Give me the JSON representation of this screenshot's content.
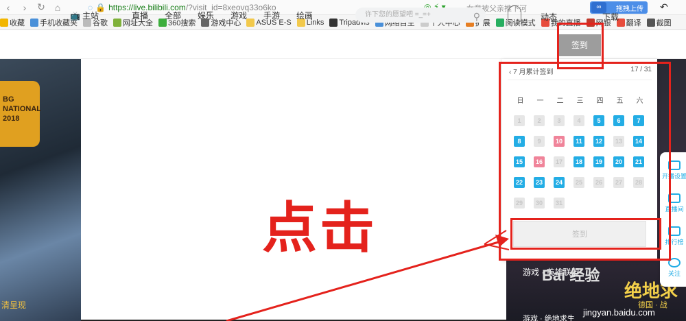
{
  "browser": {
    "url_main": "https://live.bilibili.com",
    "url_query": "/?visit_id=8xeovq33o6ko",
    "search_hint": "女童被父亲推下河",
    "upload_label": "拖拽上传",
    "upload_logo": "∞"
  },
  "bookmarks": [
    {
      "label": "收藏",
      "color": "#f2b600"
    },
    {
      "label": "手机收藏夹",
      "color": "#4a90d9"
    },
    {
      "label": "谷歌",
      "color": "#bbbbbb"
    },
    {
      "label": "网址大全",
      "color": "#7fb13a"
    },
    {
      "label": "360搜索",
      "color": "#3dae3d"
    },
    {
      "label": "游戏中心",
      "color": "#666666"
    },
    {
      "label": "ASUS E-S",
      "color": "#f2c94c"
    },
    {
      "label": "Links",
      "color": "#f2c94c"
    },
    {
      "label": "Tripadvis",
      "color": "#333333"
    },
    {
      "label": "网络自主",
      "color": "#4a90d9"
    },
    {
      "label": "个人中心",
      "color": "#cccccc"
    },
    {
      "label": "扩展",
      "color": "#e67e22"
    },
    {
      "label": "阅读模式",
      "color": "#27ae60"
    },
    {
      "label": "我的直播",
      "color": "#e74c3c"
    },
    {
      "label": "网银",
      "color": "#c0392b"
    },
    {
      "label": "翻译",
      "color": "#e74c3c"
    },
    {
      "label": "截图",
      "color": "#555555"
    }
  ],
  "site_nav": [
    "主站",
    "直播",
    "全部",
    "娱乐",
    "游戏",
    "手游",
    "绘画"
  ],
  "search_placeholder": "许下您的愿望吧 =_=+",
  "header_tabs": {
    "dynamic": "动态",
    "sign": "签到",
    "download": "下载"
  },
  "sign_panel": {
    "title": "7 月累计签到",
    "progress": "17 / 31",
    "weekdays": [
      "日",
      "一",
      "二",
      "三",
      "四",
      "五",
      "六"
    ],
    "days": [
      {
        "day": "1",
        "state": "empty"
      },
      {
        "day": "2",
        "state": "empty"
      },
      {
        "day": "3",
        "state": "empty"
      },
      {
        "day": "4",
        "state": "empty"
      },
      {
        "day": "5",
        "state": "signed"
      },
      {
        "day": "6",
        "state": "signed"
      },
      {
        "day": "7",
        "state": "signed"
      },
      {
        "day": "8",
        "state": "signed"
      },
      {
        "day": "9",
        "state": "empty"
      },
      {
        "day": "10",
        "state": "pink"
      },
      {
        "day": "11",
        "state": "signed"
      },
      {
        "day": "12",
        "state": "signed"
      },
      {
        "day": "13",
        "state": "empty"
      },
      {
        "day": "14",
        "state": "signed"
      },
      {
        "day": "15",
        "state": "signed"
      },
      {
        "day": "16",
        "state": "pink"
      },
      {
        "day": "17",
        "state": "empty"
      },
      {
        "day": "18",
        "state": "signed"
      },
      {
        "day": "19",
        "state": "signed"
      },
      {
        "day": "20",
        "state": "signed"
      },
      {
        "day": "21",
        "state": "signed"
      },
      {
        "day": "22",
        "state": "signed"
      },
      {
        "day": "23",
        "state": "signed"
      },
      {
        "day": "24",
        "state": "signed"
      },
      {
        "day": "25",
        "state": "empty"
      },
      {
        "day": "26",
        "state": "empty"
      },
      {
        "day": "27",
        "state": "empty"
      },
      {
        "day": "28",
        "state": "empty"
      },
      {
        "day": "29",
        "state": "empty"
      },
      {
        "day": "30",
        "state": "empty"
      },
      {
        "day": "31",
        "state": "empty"
      }
    ],
    "button": "签到"
  },
  "side_toolbar": [
    "开播设置",
    "直播间",
    "排行榜",
    "关注"
  ],
  "annotation": {
    "label": "点击",
    "color": "#e4221c"
  },
  "background": {
    "left_badge": "BG NATIONAL 2018",
    "left_caption": "清呈现",
    "thumb_title": "游戏 · 英雄联盟",
    "thumb_sub": "游戏 · 绝地求生",
    "game_title": "绝地求",
    "game_sub": "德国 · 战",
    "watermark": "Bai 经验",
    "watermark_url": "jingyan.baidu.com"
  }
}
